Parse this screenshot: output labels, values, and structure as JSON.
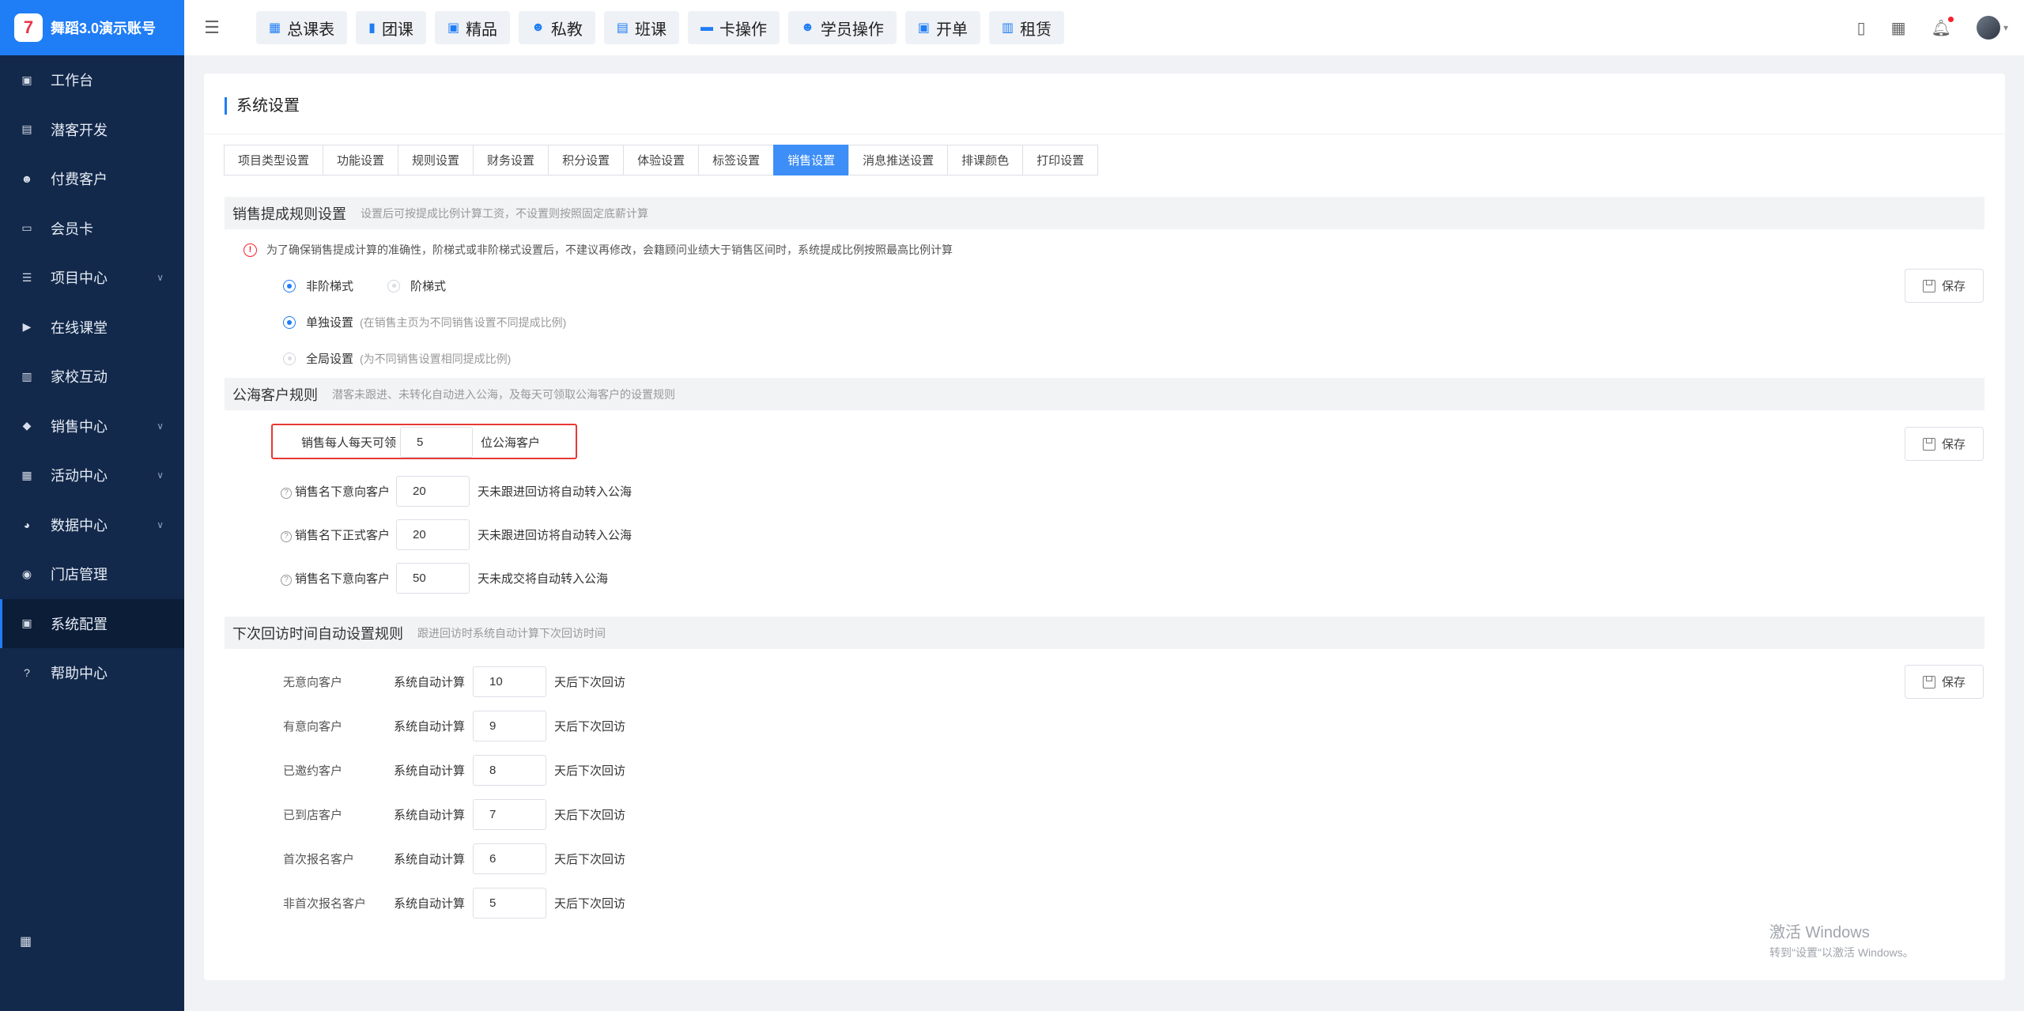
{
  "app": {
    "logo_glyph": "7",
    "name": "舞蹈3.0演示账号"
  },
  "sidebar": {
    "items": [
      {
        "label": "工作台",
        "icon": "image-icon",
        "glyph": "▣",
        "expandable": false,
        "active": false
      },
      {
        "label": "潜客开发",
        "icon": "id-card-icon",
        "glyph": "▤",
        "expandable": false,
        "active": false
      },
      {
        "label": "付费客户",
        "icon": "users-icon",
        "glyph": "☻",
        "expandable": false,
        "active": false
      },
      {
        "label": "会员卡",
        "icon": "card-icon",
        "glyph": "▭",
        "expandable": false,
        "active": false
      },
      {
        "label": "项目中心",
        "icon": "list-icon",
        "glyph": "☰",
        "expandable": true,
        "active": false
      },
      {
        "label": "在线课堂",
        "icon": "video-icon",
        "glyph": "▶",
        "expandable": false,
        "active": false
      },
      {
        "label": "家校互动",
        "icon": "contact-icon",
        "glyph": "▥",
        "expandable": false,
        "active": false
      },
      {
        "label": "销售中心",
        "icon": "tag-icon",
        "glyph": "◆",
        "expandable": true,
        "active": false
      },
      {
        "label": "活动中心",
        "icon": "activity-icon",
        "glyph": "▦",
        "expandable": true,
        "active": false
      },
      {
        "label": "数据中心",
        "icon": "pie-chart-icon",
        "glyph": "◕",
        "expandable": true,
        "active": false
      },
      {
        "label": "门店管理",
        "icon": "store-icon",
        "glyph": "◉",
        "expandable": false,
        "active": false
      },
      {
        "label": "系统配置",
        "icon": "settings-icon",
        "glyph": "▣",
        "expandable": false,
        "active": true
      },
      {
        "label": "帮助中心",
        "icon": "help-icon",
        "glyph": "?",
        "expandable": false,
        "active": false
      }
    ],
    "bottom_icon": "apps-grid-icon",
    "bottom_glyph": "▦"
  },
  "topbar": {
    "menu_glyph": "☰",
    "quick_buttons": [
      {
        "label": "总课表",
        "icon": "calendar-icon",
        "glyph": "▦"
      },
      {
        "label": "团课",
        "icon": "book-icon",
        "glyph": "▮"
      },
      {
        "label": "精品",
        "icon": "star-box-icon",
        "glyph": "▣"
      },
      {
        "label": "私教",
        "icon": "user-group-icon",
        "glyph": "☻"
      },
      {
        "label": "班课",
        "icon": "class-icon",
        "glyph": "▤"
      },
      {
        "label": "卡操作",
        "icon": "card-icon",
        "glyph": "▬"
      },
      {
        "label": "学员操作",
        "icon": "student-icon",
        "glyph": "☻"
      },
      {
        "label": "开单",
        "icon": "order-icon",
        "glyph": "▣"
      },
      {
        "label": "租赁",
        "icon": "building-icon",
        "glyph": "▥"
      }
    ],
    "right_icons": [
      {
        "name": "bookmark-icon",
        "glyph": "▯"
      },
      {
        "name": "qr-code-icon",
        "glyph": "▦"
      },
      {
        "name": "bell-icon",
        "glyph": "🔔︎"
      }
    ],
    "avatar_caret": "▾"
  },
  "page": {
    "title": "系统设置",
    "tabs": [
      {
        "label": "项目类型设置",
        "active": false
      },
      {
        "label": "功能设置",
        "active": false
      },
      {
        "label": "规则设置",
        "active": false
      },
      {
        "label": "财务设置",
        "active": false
      },
      {
        "label": "积分设置",
        "active": false
      },
      {
        "label": "体验设置",
        "active": false
      },
      {
        "label": "标签设置",
        "active": false
      },
      {
        "label": "销售设置",
        "active": true
      },
      {
        "label": "消息推送设置",
        "active": false
      },
      {
        "label": "排课颜色",
        "active": false
      },
      {
        "label": "打印设置",
        "active": false
      }
    ]
  },
  "commission": {
    "title": "销售提成规则设置",
    "desc": "设置后可按提成比例计算工资，不设置则按照固定底薪计算",
    "warning": "为了确保销售提成计算的准确性，阶梯式或非阶梯式设置后，不建议再修改，会籍顾问业绩大于销售区间时，系统提成比例按照最高比例计算",
    "warning_icon_glyph": "!",
    "mode_options": [
      {
        "label": "非阶梯式",
        "checked": true
      },
      {
        "label": "阶梯式",
        "checked": false
      }
    ],
    "scope_options": [
      {
        "label": "单独设置",
        "hint": "(在销售主页为不同销售设置不同提成比例)",
        "checked": true
      },
      {
        "label": "全局设置",
        "hint": "(为不同销售设置相同提成比例)",
        "checked": false
      }
    ],
    "save_label": "保存"
  },
  "public_pool": {
    "title": "公海客户规则",
    "desc": "潜客未跟进、未转化自动进入公海，及每天可领取公海客户的设置规则",
    "daily_claim": {
      "label": "销售每人每天可领",
      "value": "5",
      "suffix": "位公海客户"
    },
    "help_glyph": "?",
    "rules": [
      {
        "label": "销售名下意向客户",
        "value": "20",
        "suffix": "天未跟进回访将自动转入公海"
      },
      {
        "label": "销售名下正式客户",
        "value": "20",
        "suffix": "天未跟进回访将自动转入公海"
      },
      {
        "label": "销售名下意向客户",
        "value": "50",
        "suffix": "天未成交将自动转入公海"
      }
    ],
    "save_label": "保存"
  },
  "followup": {
    "title": "下次回访时间自动设置规则",
    "desc": "跟进回访时系统自动计算下次回访时间",
    "rows": [
      {
        "label": "无意向客户",
        "mid": "系统自动计算",
        "value": "10",
        "suffix": "天后下次回访"
      },
      {
        "label": "有意向客户",
        "mid": "系统自动计算",
        "value": "9",
        "suffix": "天后下次回访"
      },
      {
        "label": "已邀约客户",
        "mid": "系统自动计算",
        "value": "8",
        "suffix": "天后下次回访"
      },
      {
        "label": "已到店客户",
        "mid": "系统自动计算",
        "value": "7",
        "suffix": "天后下次回访"
      },
      {
        "label": "首次报名客户",
        "mid": "系统自动计算",
        "value": "6",
        "suffix": "天后下次回访"
      },
      {
        "label": "非首次报名客户",
        "mid": "系统自动计算",
        "value": "5",
        "suffix": "天后下次回访"
      }
    ],
    "save_label": "保存"
  },
  "watermark": {
    "title": "激活 Windows",
    "subtitle": "转到\"设置\"以激活 Windows。"
  }
}
